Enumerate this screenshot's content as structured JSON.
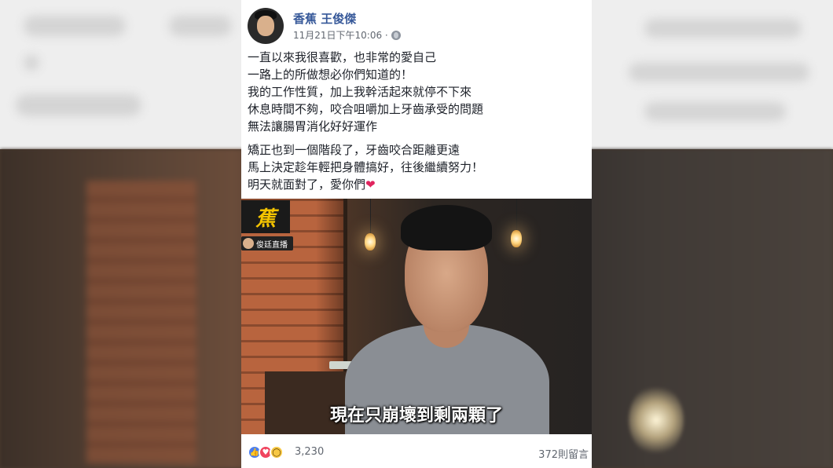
{
  "post": {
    "author": "香蕉 王俊傑",
    "timestamp": "11月21日下午10:06 ·",
    "privacy_icon": "globe-icon",
    "paragraph1": [
      "一直以來我很喜歡，也非常的愛自己",
      "一路上的所做想必你們知道的！",
      "我的工作性質，加上我幹活起來就停不下來",
      "休息時間不夠，咬合咀嚼加上牙齒承受的問題",
      "無法讓腸胃消化好好運作"
    ],
    "paragraph2": [
      "矯正也到一個階段了，牙齒咬合距離更遠",
      "馬上決定趁年輕把身體搞好，往後繼續努力！",
      "明天就面對了，愛你們"
    ],
    "heart_emoji": "❤"
  },
  "video": {
    "logo_text": "蕉",
    "channel_tag": "俊廷直播",
    "subtitle": "現在只崩壞到剩兩顆了"
  },
  "reactions": {
    "icons": [
      "like-icon",
      "love-icon",
      "wow-icon"
    ],
    "count": "3,230",
    "comments": "372則留言"
  },
  "colors": {
    "author_link": "#365899",
    "meta_text": "#616770",
    "body_text": "#1d2129"
  }
}
